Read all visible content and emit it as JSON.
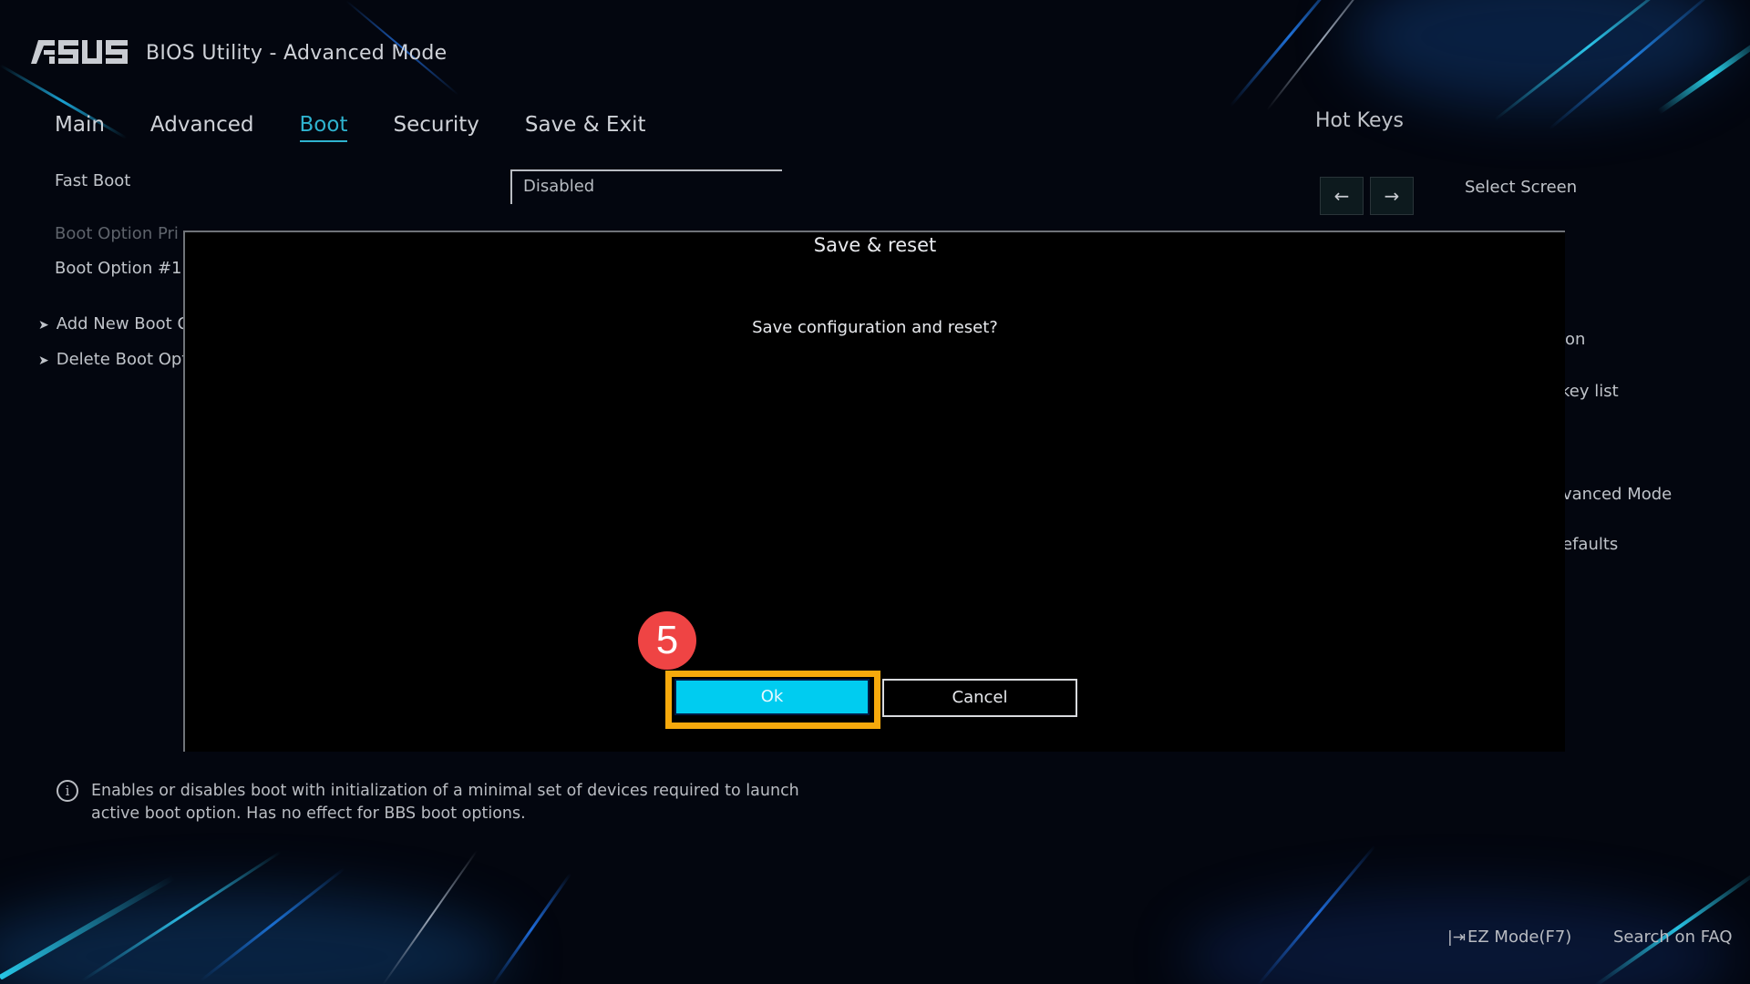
{
  "header": {
    "brand": "ASUS",
    "title": "BIOS Utility - Advanced Mode"
  },
  "nav": {
    "tabs": [
      {
        "label": "Main",
        "active": false
      },
      {
        "label": "Advanced",
        "active": false
      },
      {
        "label": "Boot",
        "active": true
      },
      {
        "label": "Security",
        "active": false
      },
      {
        "label": "Save & Exit",
        "active": false
      }
    ]
  },
  "settings": {
    "fast_boot": {
      "label": "Fast Boot",
      "value": "Disabled"
    },
    "boot_option_priorities": "Boot Option Pri",
    "boot_option_1": "Boot Option #1",
    "add_new_boot": "Add New Boot O",
    "delete_boot": "Delete Boot Opt"
  },
  "hotkeys": {
    "title": "Hot Keys",
    "left_key": "←",
    "right_key": "→",
    "items": [
      "Select Screen",
      "on",
      "key list",
      "",
      "vanced Mode",
      "efaults"
    ]
  },
  "dialog": {
    "title": "Save & reset",
    "message": "Save configuration and reset?",
    "ok_label": "Ok",
    "cancel_label": "Cancel",
    "step_number": "5"
  },
  "help": {
    "text": "Enables or disables boot with initialization of a minimal set of devices required to launch active boot option. Has no effect for BBS boot options."
  },
  "footer": {
    "ez_mode": "EZ Mode(F7)",
    "search_faq": "Search on FAQ"
  },
  "colors": {
    "accent": "#2fb3cf",
    "ok_button": "#00ccf0",
    "highlight": "#f6a90c",
    "badge": "#ef4444"
  }
}
